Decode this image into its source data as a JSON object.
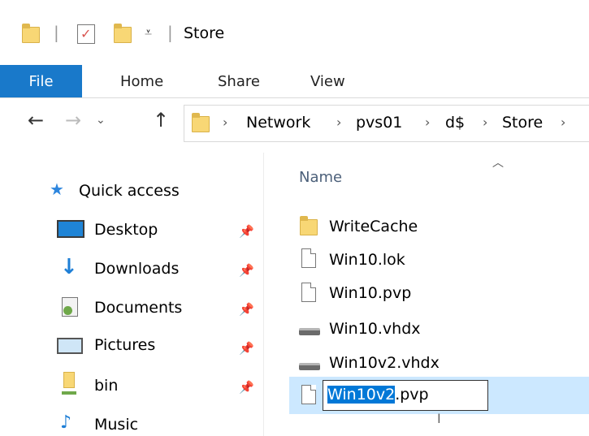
{
  "window": {
    "title": "Store"
  },
  "ribbon": {
    "tabs": [
      "File",
      "Home",
      "Share",
      "View"
    ]
  },
  "address": {
    "crumbs": [
      "Network",
      "pvs01",
      "d$",
      "Store"
    ]
  },
  "nav_pane": {
    "items": [
      {
        "label": "Quick access",
        "icon": "star-icon",
        "pinned": false
      },
      {
        "label": "Desktop",
        "icon": "desktop-icon",
        "pinned": true
      },
      {
        "label": "Downloads",
        "icon": "download-arrow-icon",
        "pinned": true
      },
      {
        "label": "Documents",
        "icon": "documents-icon",
        "pinned": true
      },
      {
        "label": "Pictures",
        "icon": "pictures-icon",
        "pinned": true
      },
      {
        "label": "bin",
        "icon": "folder-icon",
        "pinned": true
      },
      {
        "label": "Music",
        "icon": "music-note-icon",
        "pinned": false
      }
    ]
  },
  "file_list": {
    "column_name": "Name",
    "files": [
      {
        "name": "WriteCache",
        "type": "folder"
      },
      {
        "name": "Win10.lok",
        "type": "file"
      },
      {
        "name": "Win10.pvp",
        "type": "file"
      },
      {
        "name": "Win10.vhdx",
        "type": "disk"
      },
      {
        "name": "Win10v2.vhdx",
        "type": "disk"
      }
    ],
    "renaming": {
      "selected_part": "Win10v2",
      "rest": ".pvp"
    }
  },
  "colors": {
    "file_tab": "#1979ca",
    "selection": "#cce8ff",
    "text_selection": "#0078d7"
  }
}
